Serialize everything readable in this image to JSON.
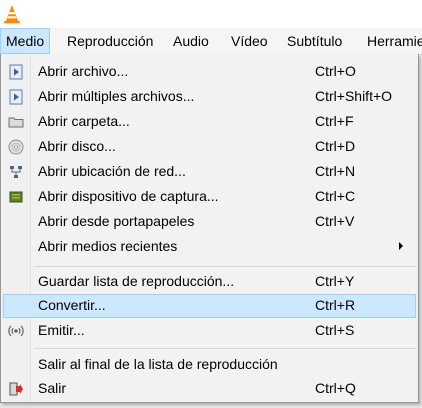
{
  "menubar": {
    "items": [
      {
        "label": "Medio",
        "active": true
      },
      {
        "label": "Reproducción"
      },
      {
        "label": "Audio"
      },
      {
        "label": "Vídeo"
      },
      {
        "label": "Subtítulo"
      },
      {
        "label": "Herramie"
      }
    ]
  },
  "menu": {
    "items": [
      {
        "label": "Abrir archivo...",
        "shortcut": "Ctrl+O",
        "icon": "file-play-icon"
      },
      {
        "label": "Abrir múltiples archivos...",
        "shortcut": "Ctrl+Shift+O",
        "icon": "file-play-icon"
      },
      {
        "label": "Abrir carpeta...",
        "shortcut": "Ctrl+F",
        "icon": "folder-icon"
      },
      {
        "label": "Abrir disco...",
        "shortcut": "Ctrl+D",
        "icon": "disc-icon"
      },
      {
        "label": "Abrir ubicación de red...",
        "shortcut": "Ctrl+N",
        "icon": "network-icon"
      },
      {
        "label": "Abrir dispositivo de captura...",
        "shortcut": "Ctrl+C",
        "icon": "capture-card-icon"
      },
      {
        "label": "Abrir desde portapapeles",
        "shortcut": "Ctrl+V",
        "icon": ""
      },
      {
        "label": "Abrir medios recientes",
        "shortcut": "",
        "icon": "",
        "submenu": true
      },
      {
        "label": "Guardar lista de reproducción...",
        "shortcut": "Ctrl+Y",
        "icon": ""
      },
      {
        "label": "Convertir...",
        "shortcut": "Ctrl+R",
        "icon": "",
        "highlighted": true
      },
      {
        "label": "Emitir...",
        "shortcut": "Ctrl+S",
        "icon": "stream-icon"
      },
      {
        "label": "Salir al final de la lista de reproducción",
        "shortcut": "",
        "icon": ""
      },
      {
        "label": "Salir",
        "shortcut": "Ctrl+Q",
        "icon": "exit-icon"
      }
    ]
  },
  "colors": {
    "highlight": "#cce8ff",
    "highlight_border": "#99d1ff",
    "vlc_orange": "#ff8800"
  }
}
